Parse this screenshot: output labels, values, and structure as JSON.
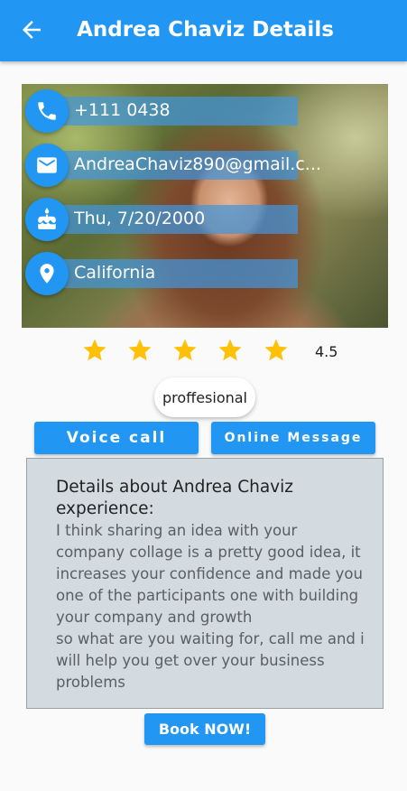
{
  "appbar": {
    "title": "Andrea Chaviz Details"
  },
  "contact": [
    {
      "icon": "phone-icon",
      "text": "+111 0438"
    },
    {
      "icon": "email-icon",
      "text": "AndreaChaviz890@gmail.c..."
    },
    {
      "icon": "cake-icon",
      "text": "Thu, 7/20/2000"
    },
    {
      "icon": "location-pin-icon",
      "text": "California"
    }
  ],
  "rating": {
    "value": 4.5,
    "label": "4.5",
    "stars_shown": 5
  },
  "chip": {
    "label": "proffesional"
  },
  "actions": {
    "voice_call": "Voice call",
    "online_message": "Online Message",
    "book_now": "Book NOW!"
  },
  "details": {
    "heading": "Details about Andrea Chaviz experience:",
    "body": "I think sharing an idea with your company collage is a pretty good idea, it increases your confidence and made you one of the participants one with building your company and growth\nso what are you waiting for, call me and i will help you get over your business problems"
  },
  "colors": {
    "primary": "#2196f3",
    "star": "#ffc107",
    "details_bg": "#d3dbe0"
  }
}
